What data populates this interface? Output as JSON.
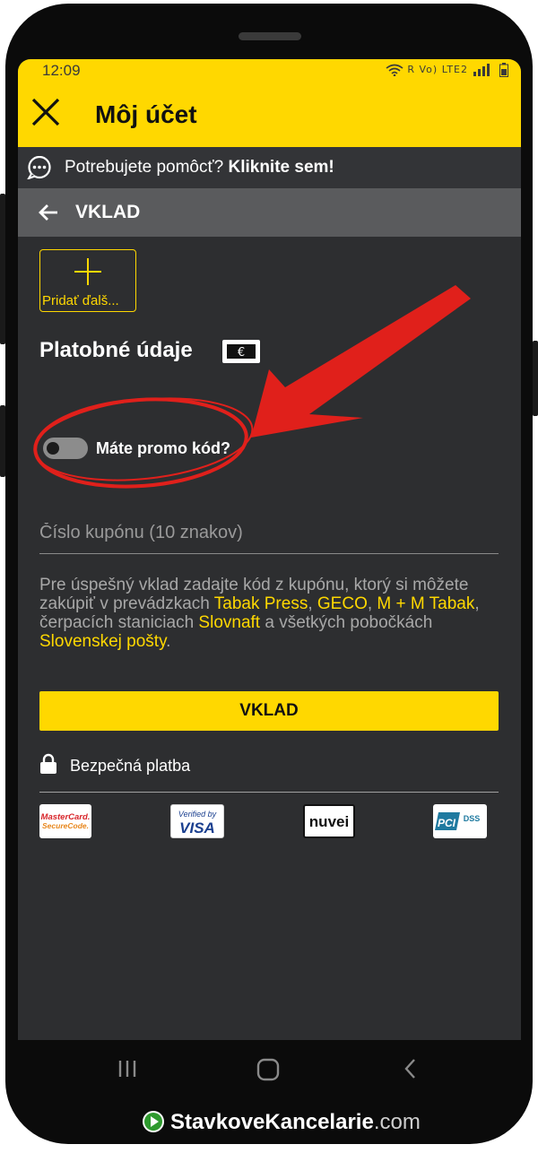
{
  "status_bar": {
    "time": "12:09",
    "signal_text": "R Vo) LTE2"
  },
  "app_bar": {
    "title": "Môj účet"
  },
  "help_bar": {
    "text": "Potrebujete pomôcť?",
    "link": "Kliknite sem!"
  },
  "section": {
    "title": "VKLAD"
  },
  "add_card": {
    "label": "Pridať ďalš..."
  },
  "payment": {
    "title": "Platobné údaje"
  },
  "promo": {
    "label": "Máte promo kód?",
    "enabled": false
  },
  "coupon": {
    "placeholder": "Číslo kupónu (10 znakov)",
    "value": ""
  },
  "info": {
    "part1": "Pre úspešný vklad zadajte kód z kupónu, ktorý si môžete zakúpiť v prevádzkach ",
    "link1": "Tabak Press",
    "sep1": ", ",
    "link2": "GECO",
    "sep2": ", ",
    "link3": "M + M Tabak",
    "part2": ", čerpacích staniciach ",
    "link4": "Slovnaft",
    "part3": " a všetkých pobočkách ",
    "link5": "Slovenskej pošty",
    "part4": "."
  },
  "deposit_button": {
    "label": "VKLAD"
  },
  "secure": {
    "label": "Bezpečná platba"
  },
  "logos": {
    "mastercard": [
      "MasterCard.",
      "SecureCode."
    ],
    "visa": [
      "Verified by",
      "VISA"
    ],
    "nuvei": "nuvei",
    "pci": [
      "PCI",
      "DSS"
    ]
  },
  "watermark": {
    "main": "StavkoveKancelarie",
    "suffix": ".com"
  },
  "colors": {
    "accent": "#ffd800",
    "background": "#2d2e30",
    "annotation": "#e0201b"
  },
  "icons": {
    "close": "close-icon",
    "help": "chat-bubble-icon",
    "back": "arrow-left-icon",
    "add": "plus-icon",
    "euro": "euro-banknote-icon",
    "lock": "lock-icon"
  }
}
